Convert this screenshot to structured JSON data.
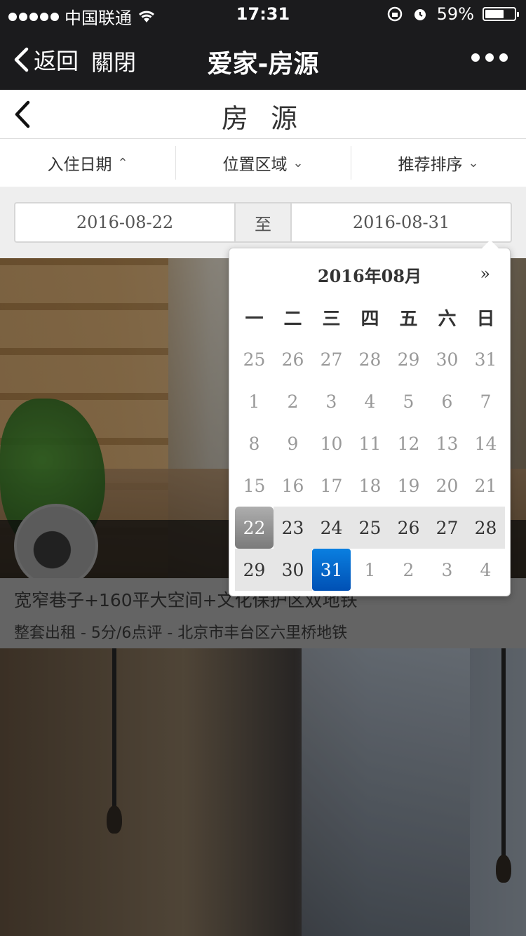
{
  "status_bar": {
    "carrier": "中国联通",
    "time": "17:31",
    "battery": "59%",
    "battery_level": 0.59
  },
  "nav": {
    "back_label": "返回",
    "close_label": "關閉",
    "title": "爱家-房源"
  },
  "page": {
    "title": "房 源"
  },
  "filters": [
    {
      "label": "入住日期",
      "arrow": "⌃"
    },
    {
      "label": "位置区域",
      "arrow": "⌄"
    },
    {
      "label": "推荐排序",
      "arrow": "⌄"
    }
  ],
  "date_range": {
    "from": "2016-08-22",
    "separator": "至",
    "to": "2016-08-31"
  },
  "calendar": {
    "month_label": "2016年08月",
    "next_label": "»",
    "weekdays": [
      "一",
      "二",
      "三",
      "四",
      "五",
      "六",
      "日"
    ],
    "weeks": [
      [
        "25",
        "26",
        "27",
        "28",
        "29",
        "30",
        "31"
      ],
      [
        "1",
        "2",
        "3",
        "4",
        "5",
        "6",
        "7"
      ],
      [
        "8",
        "9",
        "10",
        "11",
        "12",
        "13",
        "14"
      ],
      [
        "15",
        "16",
        "17",
        "18",
        "19",
        "20",
        "21"
      ],
      [
        "22",
        "23",
        "24",
        "25",
        "26",
        "27",
        "28"
      ],
      [
        "29",
        "30",
        "31",
        "1",
        "2",
        "3",
        "4"
      ]
    ]
  },
  "listing": {
    "name": "宽窄巷子+160平大空间+文化保护区双地铁",
    "meta": "整套出租 - 5分/6点评 - 北京市丰台区六里桥地铁"
  }
}
